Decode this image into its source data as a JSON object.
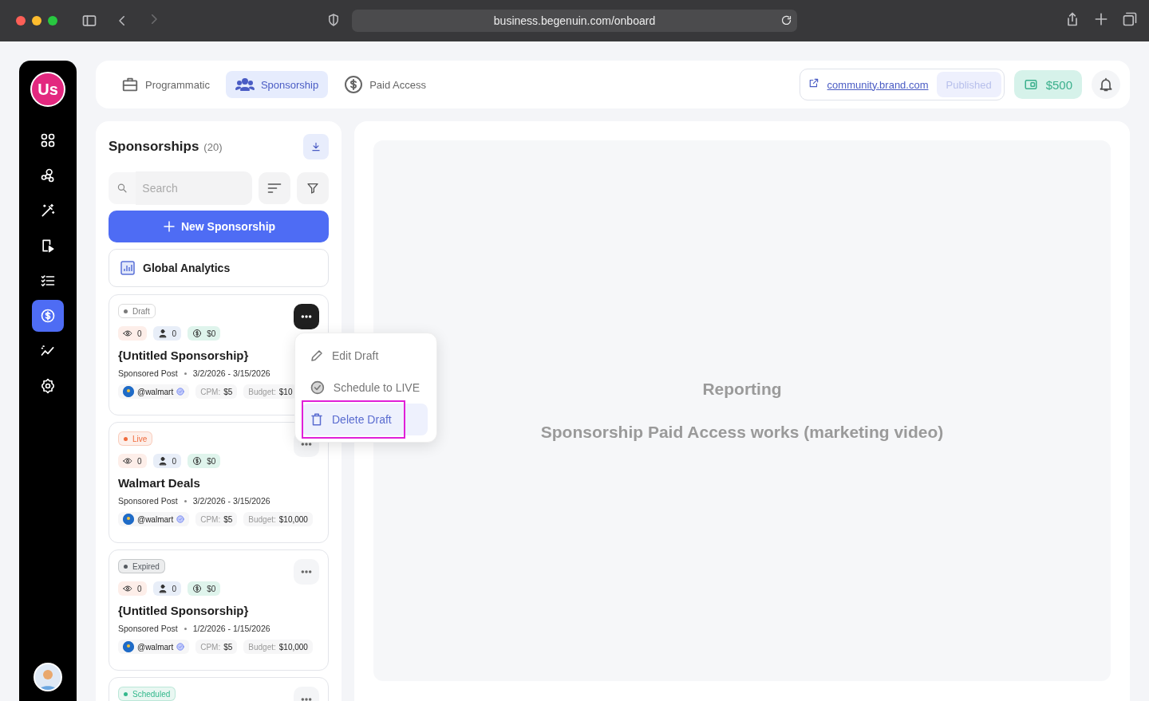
{
  "browser": {
    "url": "business.begenuin.com/onboard"
  },
  "sidebar": {
    "logo": "Us",
    "items": [
      {
        "kind": "grid",
        "selected": false
      },
      {
        "kind": "network",
        "selected": false
      },
      {
        "kind": "wand",
        "selected": false
      },
      {
        "kind": "video",
        "selected": false
      },
      {
        "kind": "checklist",
        "selected": false
      },
      {
        "kind": "dollar",
        "selected": true
      },
      {
        "kind": "trend",
        "selected": false
      },
      {
        "kind": "settings",
        "selected": false
      }
    ]
  },
  "top_tabs": [
    {
      "label": "Programmatic",
      "kind": "briefcase",
      "selected": false
    },
    {
      "label": "Sponsorship",
      "kind": "people",
      "selected": true
    },
    {
      "label": "Paid Access",
      "kind": "dollar",
      "selected": false
    }
  ],
  "community": {
    "link": "community.brand.com",
    "status": "Published"
  },
  "wallet": {
    "balance": "$500"
  },
  "list": {
    "title": "Sponsorships",
    "count": "(20)",
    "search": {
      "placeholder": "Search"
    },
    "new_button": "New Sponsorship",
    "analytics": "Global Analytics",
    "cards": [
      {
        "status": "Draft",
        "color": "#7a7a7a",
        "views": "0",
        "members": "0",
        "earnings": "$0",
        "title": "{Untitled Sponsorship}",
        "type": "Sponsored Post",
        "dates": "3/2/2026 - 3/15/2026",
        "handle": "@walmart",
        "cpm": "CPM: **$5**",
        "budget": "Budget: **$10**",
        "menu_open": true
      },
      {
        "status": "Live",
        "color": "#f06b3c",
        "views": "0",
        "members": "0",
        "earnings": "$0",
        "title": "Walmart Deals",
        "type": "Sponsored Post",
        "dates": "3/2/2026 - 3/15/2026",
        "handle": "@walmart",
        "cpm": "CPM: **$5**",
        "budget": "Budget: **$10,000**",
        "menu_open": false
      },
      {
        "status": "Expired",
        "color": "#555a60",
        "views": "0",
        "members": "0",
        "earnings": "$0",
        "title": "{Untitled Sponsorship}",
        "type": "Sponsored Post",
        "dates": "1/2/2026 - 1/15/2026",
        "handle": "@walmart",
        "cpm": "CPM: **$5**",
        "budget": "Budget: **$10,000**",
        "menu_open": false
      },
      {
        "status": "Scheduled",
        "color": "#33b88c",
        "menu_open": false
      }
    ]
  },
  "menu": {
    "items": [
      {
        "label": "Edit Draft",
        "kind": "edit",
        "selected": false,
        "annotated": false
      },
      {
        "label": "Schedule to LIVE",
        "kind": "check",
        "selected": false,
        "annotated": false
      },
      {
        "label": "Delete Draft",
        "kind": "trash",
        "selected": true,
        "annotated": true
      }
    ]
  },
  "report": {
    "title": "Reporting",
    "subtitle": "Sponsorship Paid Access works (marketing video)"
  }
}
